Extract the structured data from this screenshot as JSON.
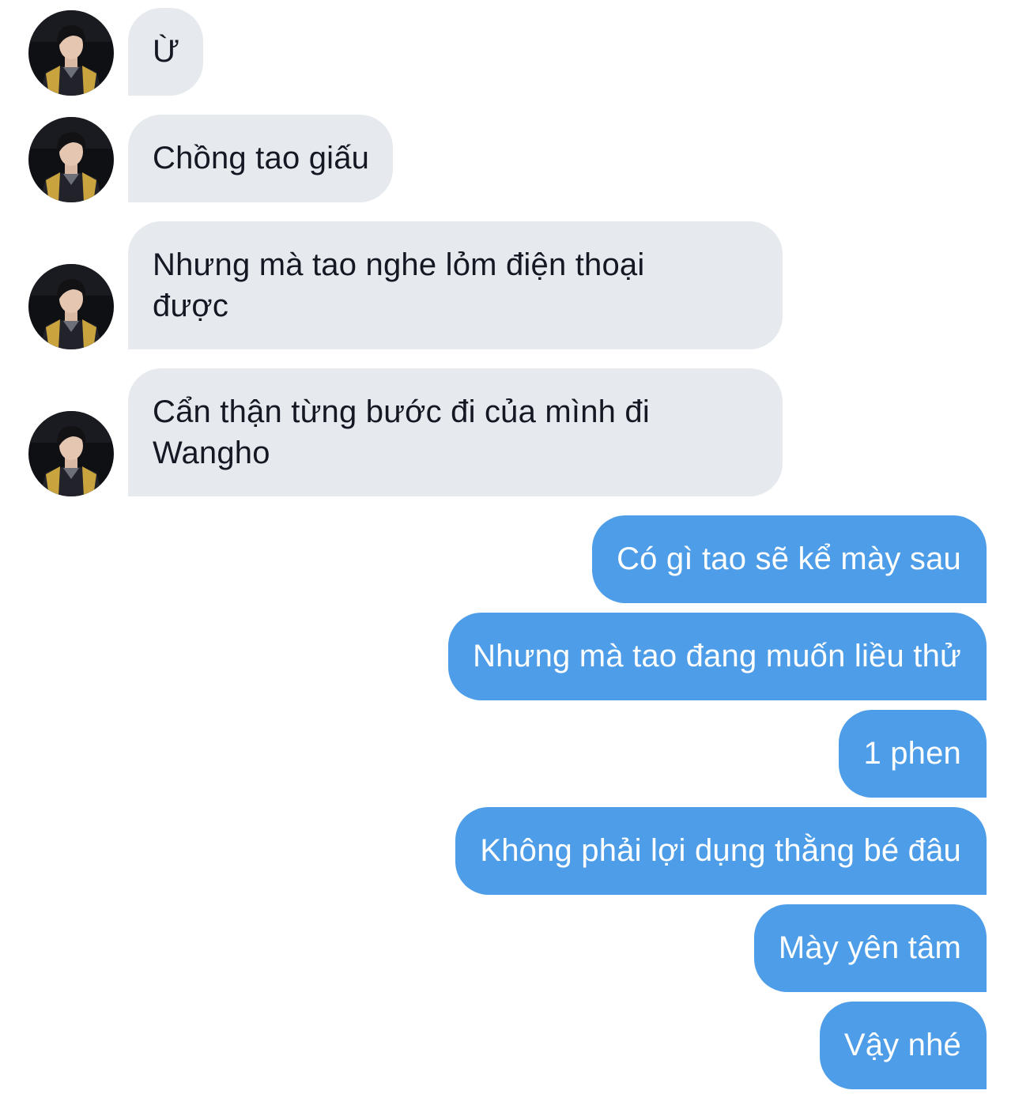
{
  "conversation": {
    "contact_avatar_icon": "user-avatar-photo-icon",
    "colors": {
      "incoming_bubble": "#e6eaee",
      "incoming_text": "#141823",
      "outgoing_bubble": "#4e9de8",
      "outgoing_text": "#ffffff"
    },
    "incoming": [
      {
        "lines": [
          "Ừ"
        ]
      },
      {
        "lines": [
          "Chồng tao giấu"
        ]
      },
      {
        "lines": [
          "Nhưng mà tao nghe lỏm điện thoại",
          "được"
        ]
      },
      {
        "lines": [
          "Cẩn thận từng bước đi của mình đi",
          "Wangho"
        ]
      }
    ],
    "outgoing": [
      {
        "text": "Có gì tao sẽ kể mày sau"
      },
      {
        "text": "Nhưng mà tao đang muốn liều thử"
      },
      {
        "text": "1 phen"
      },
      {
        "text": "Không phải lợi dụng thằng bé đâu"
      },
      {
        "text": "Mày yên tâm"
      },
      {
        "text": "Vậy nhé"
      }
    ]
  }
}
